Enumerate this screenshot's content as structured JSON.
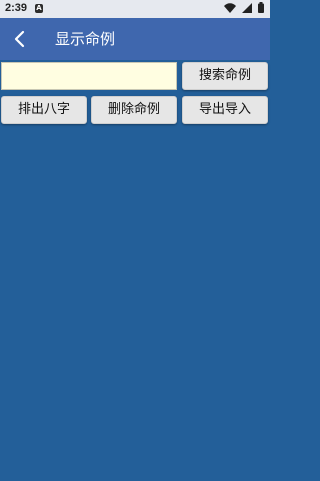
{
  "status_bar": {
    "time": "2:39",
    "notification_letter": "A",
    "icons": [
      "wifi-icon",
      "signal-icon",
      "battery-icon"
    ]
  },
  "header": {
    "back_icon": "chevron-left-icon",
    "title": "显示命例"
  },
  "search": {
    "value": "",
    "placeholder": "",
    "button_label": "搜索命例"
  },
  "actions": {
    "paipan_label": "排出八字",
    "delete_label": "删除命例",
    "export_import_label": "导出导入"
  },
  "colors": {
    "background": "#235f99",
    "app_bar": "#3f67ae",
    "input_background": "#fffee1",
    "button_background": "#e6e6e6"
  }
}
